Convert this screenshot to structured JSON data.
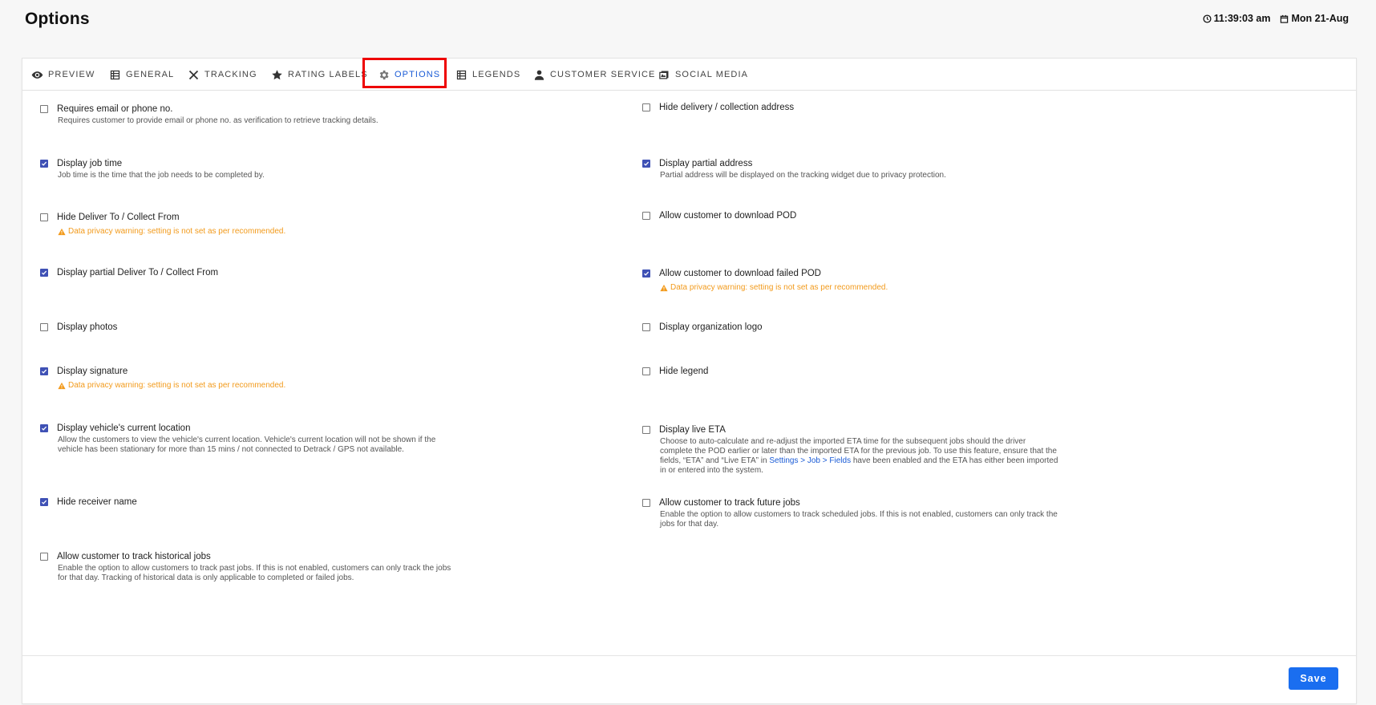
{
  "header": {
    "title": "Options",
    "time": "11:39:03 am",
    "date": "Mon 21-Aug"
  },
  "tabs": [
    {
      "label": "PREVIEW",
      "icon": "eye-icon"
    },
    {
      "label": "GENERAL",
      "icon": "list-icon"
    },
    {
      "label": "TRACKING",
      "icon": "tools-icon"
    },
    {
      "label": "RATING LABELS",
      "icon": "star-icon"
    },
    {
      "label": "OPTIONS",
      "icon": "gear-icon",
      "active": true
    },
    {
      "label": "LEGENDS",
      "icon": "list-icon"
    },
    {
      "label": "CUSTOMER SERVICE",
      "icon": "user-icon"
    },
    {
      "label": "SOCIAL MEDIA",
      "icon": "media-icon"
    }
  ],
  "warning_text": "Data privacy warning: setting is not set as per recommended.",
  "left_options": [
    {
      "label": "Requires email or phone no.",
      "checked": false,
      "desc": "Requires customer to provide email or phone no. as verification to retrieve tracking details."
    },
    {
      "label": "Display job time",
      "checked": true,
      "desc": "Job time is the time that the job needs to be completed by."
    },
    {
      "label": "Hide Deliver To / Collect From",
      "checked": false,
      "warning": true
    },
    {
      "label": "Display partial Deliver To / Collect From",
      "checked": true
    },
    {
      "label": "Display photos",
      "checked": false
    },
    {
      "label": "Display signature",
      "checked": true,
      "warning": true
    },
    {
      "label": "Display vehicle's current location",
      "checked": true,
      "desc": "Allow the customers to view the vehicle's current location. Vehicle's current location will not be shown if the vehicle has been stationary for more than 15 mins / not connected to Detrack / GPS not available."
    },
    {
      "label": "Hide receiver name",
      "checked": true
    },
    {
      "label": "Allow customer to track historical jobs",
      "checked": false,
      "desc": "Enable the option to allow customers to track past jobs. If this is not enabled, customers can only track the jobs for that day. Tracking of historical data is only applicable to completed or failed jobs."
    }
  ],
  "right_options": [
    {
      "label": "Hide delivery / collection address",
      "checked": false
    },
    {
      "label": "Display partial address",
      "checked": true,
      "desc": "Partial address will be displayed on the tracking widget due to privacy protection."
    },
    {
      "label": "Allow customer to download POD",
      "checked": false
    },
    {
      "label": "Allow customer to download failed POD",
      "checked": true,
      "warning": true
    },
    {
      "label": "Display organization logo",
      "checked": false
    },
    {
      "label": "Hide legend",
      "checked": false
    },
    {
      "label": "Display live ETA",
      "checked": false,
      "desc_pre": "Choose to auto-calculate and re-adjust the imported ETA time for the subsequent jobs should the driver complete the POD earlier or later than the imported ETA for the previous job. To use this feature, ensure that the fields, “ETA” and “Live ETA” in ",
      "desc_link": "Settings > Job > Fields",
      "desc_post": " have been enabled and the ETA has either been imported in or entered into the system."
    },
    {
      "label": "Allow customer to track future jobs",
      "checked": false,
      "desc": "Enable the option to allow customers to track scheduled jobs. If this is not enabled, customers can only track the jobs for that day."
    }
  ],
  "save_label": "Save",
  "colors": {
    "accent": "#1a6ef0",
    "checkbox": "#3f51b5",
    "warning": "#f29a1b",
    "highlight": "#e00000"
  }
}
